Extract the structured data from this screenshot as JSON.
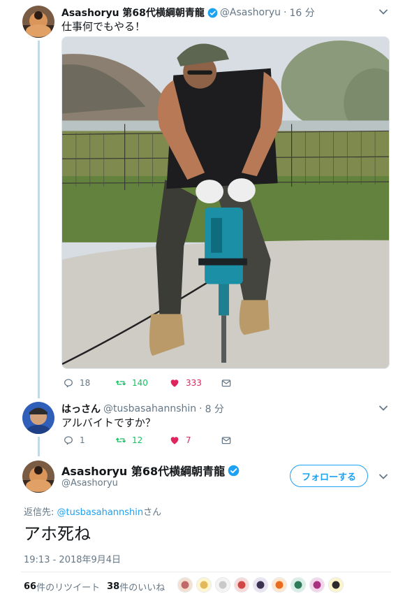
{
  "tweet1": {
    "display_name": "Asashoryu 第68代横綱朝青龍",
    "handle": "@Asashoryu",
    "dot": "·",
    "time": "16 分",
    "text": "仕事何でもやる！",
    "reply_count": "18",
    "retweet_count": "140",
    "like_count": "333"
  },
  "tweet2": {
    "display_name": "はっさん",
    "handle": "@tusbasahannshin",
    "dot": "·",
    "time": "8 分",
    "text": "アルバイトですか？",
    "reply_count": "1",
    "retweet_count": "12",
    "like_count": "7"
  },
  "tweet3": {
    "display_name": "Asashoryu 第68代横綱朝青龍",
    "handle": "@Asashoryu",
    "follow_label": "フォローする",
    "reply_prefix": "返信先: ",
    "reply_mention": "@tusbasahannshin",
    "reply_suffix": "さん",
    "text": "アホ死ね",
    "timestamp": "19:13 - 2018年9月4日",
    "retweets_num": "66",
    "retweets_label": "件のリツイート",
    "likes_num": "38",
    "likes_label": " 件のいいね"
  },
  "colors": {
    "accent": "#1da1f2",
    "retweet": "#17bf63",
    "like": "#e0245e",
    "muted": "#657786"
  },
  "icons": [
    "verified-icon",
    "chevron-down-icon",
    "reply-icon",
    "retweet-icon",
    "heart-icon",
    "dm-icon"
  ]
}
